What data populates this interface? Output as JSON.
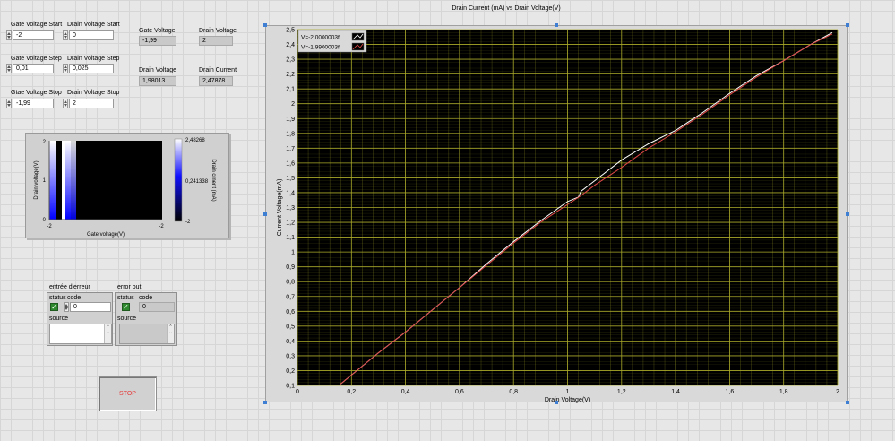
{
  "controls": {
    "gate_voltage_start": {
      "label": "Gate Voltage Start",
      "value": "-2"
    },
    "drain_voltage_start": {
      "label": "Drain Voltage Start",
      "value": "0"
    },
    "gate_voltage_step": {
      "label": "Gate Voltage Step",
      "value": "0,01"
    },
    "drain_voltage_step": {
      "label": "Drain Voltage Step",
      "value": "0,025"
    },
    "gate_voltage_stop": {
      "label": "Gtae Voltage Stop",
      "value": "-1,99"
    },
    "drain_voltage_stop": {
      "label": "Drain Voltage Stop",
      "value": "2"
    }
  },
  "indicators": {
    "gate_voltage": {
      "label": "Gate Voltage",
      "value": "-1,99"
    },
    "drain_voltage_top": {
      "label": "Drain Voltage",
      "value": "2"
    },
    "drain_voltage": {
      "label": "Drain Voltage",
      "value": "1,98013"
    },
    "drain_current": {
      "label": "Drain Current",
      "value": "2,47878"
    }
  },
  "intensity": {
    "ylabel": "Drain voltage(V)",
    "xlabel": "Gate voltage(V)",
    "y_ticks": [
      "2",
      "1",
      "0"
    ],
    "x_ticks": [
      "-2",
      "-2"
    ],
    "scale_label": "Drain crnent (mA)",
    "scale_ticks": [
      "2,48268",
      "0,241338",
      "-2"
    ]
  },
  "error_in": {
    "title": "entrée d'erreur",
    "status_label": "status",
    "code_label": "code",
    "code_value": "0",
    "source_label": "source",
    "status_glyph": "✓"
  },
  "error_out": {
    "title": "error out",
    "status_label": "status",
    "code_label": "code",
    "code_value": "0",
    "source_label": "source",
    "status_glyph": "✓"
  },
  "stop_button": {
    "label": "STOP",
    "color": "#e53a3a"
  },
  "colors": {
    "plot_bg": "#000000",
    "grid": "#a9a92a",
    "series_white": "#ffffff",
    "series_red": "#e04848"
  },
  "chart_data": {
    "type": "line",
    "title": "Drain Current (mA) vs Drain Voltage(V)",
    "xlabel": "Drain Voltage(V)",
    "ylabel": "Current Voltage(mA)",
    "xlim": [
      0,
      2
    ],
    "ylim": [
      0.1,
      2.5
    ],
    "x_ticks": [
      "0",
      "0,2",
      "0,4",
      "0,6",
      "0,8",
      "1",
      "1,2",
      "1,4",
      "1,6",
      "1,8",
      "2"
    ],
    "y_ticks": [
      "0,1",
      "0,2",
      "0,3",
      "0,4",
      "0,5",
      "0,6",
      "0,7",
      "0,8",
      "0,9",
      "1",
      "1,1",
      "1,2",
      "1,3",
      "1,4",
      "1,5",
      "1,6",
      "1,7",
      "1,8",
      "1,9",
      "2",
      "2,1",
      "2,2",
      "2,3",
      "2,4",
      "2,5"
    ],
    "grid": true,
    "legend_position": "top-left",
    "series": [
      {
        "name": "V=-2,0000003f",
        "color": "#ffffff",
        "x": [
          0.16,
          0.2,
          0.3,
          0.4,
          0.5,
          0.6,
          0.7,
          0.8,
          0.9,
          1.0,
          1.04,
          1.05,
          1.1,
          1.2,
          1.3,
          1.4,
          1.5,
          1.6,
          1.7,
          1.8,
          1.9,
          1.98
        ],
        "y": [
          0.11,
          0.17,
          0.32,
          0.46,
          0.61,
          0.76,
          0.92,
          1.07,
          1.21,
          1.34,
          1.37,
          1.41,
          1.48,
          1.62,
          1.73,
          1.82,
          1.94,
          2.07,
          2.19,
          2.29,
          2.4,
          2.48
        ]
      },
      {
        "name": "V=-1,9900003f",
        "color": "#e04848",
        "x": [
          0.16,
          0.2,
          0.3,
          0.4,
          0.5,
          0.6,
          0.7,
          0.8,
          0.9,
          1.0,
          1.05,
          1.1,
          1.2,
          1.3,
          1.4,
          1.5,
          1.6,
          1.7,
          1.8,
          1.9,
          1.98
        ],
        "y": [
          0.11,
          0.17,
          0.32,
          0.46,
          0.61,
          0.76,
          0.91,
          1.06,
          1.2,
          1.32,
          1.38,
          1.45,
          1.57,
          1.7,
          1.81,
          1.93,
          2.06,
          2.18,
          2.29,
          2.4,
          2.47
        ]
      }
    ]
  }
}
